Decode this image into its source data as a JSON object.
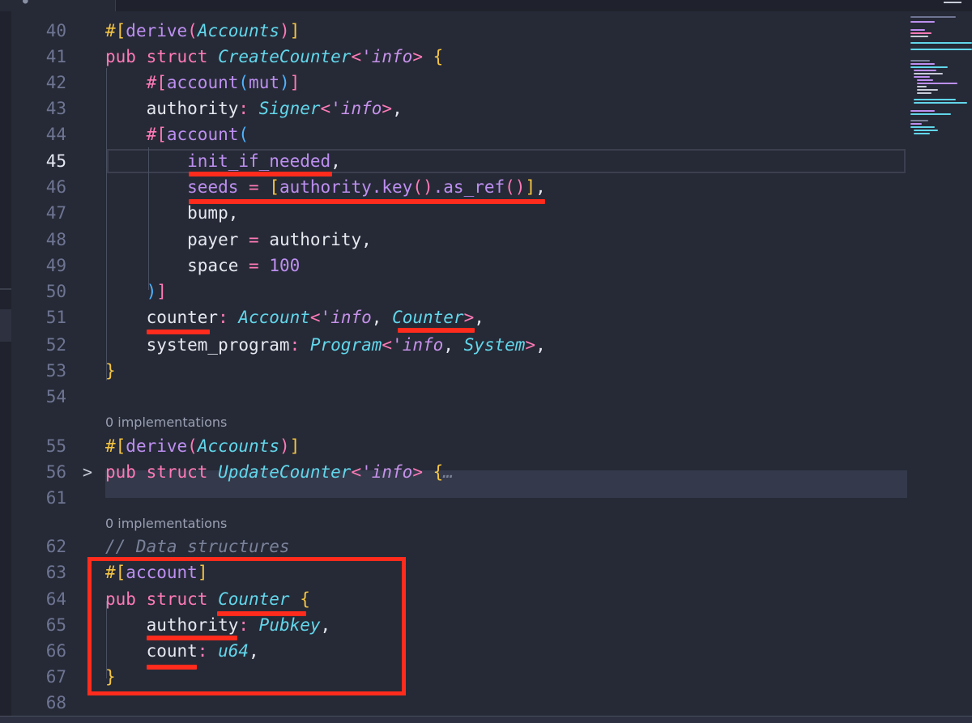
{
  "code": {
    "lines": [
      {
        "n": "40",
        "fold": "",
        "tokens": [
          [
            "br",
            "#["
          ],
          [
            "fn",
            "derive"
          ],
          [
            "br2",
            "("
          ],
          [
            "ty",
            "Accounts"
          ],
          [
            "br2",
            ")"
          ],
          [
            "br",
            "]"
          ]
        ]
      },
      {
        "n": "41",
        "fold": "",
        "tokens": [
          [
            "kw",
            "pub struct "
          ],
          [
            "ty",
            "CreateCounter"
          ],
          [
            "op",
            "<"
          ],
          [
            "lt",
            "'info"
          ],
          [
            "op",
            "> "
          ],
          [
            "br",
            "{"
          ]
        ]
      },
      {
        "n": "42",
        "fold": "",
        "tokens": [
          [
            "pl",
            "    "
          ],
          [
            "br2",
            "#["
          ],
          [
            "fn",
            "account"
          ],
          [
            "br3",
            "("
          ],
          [
            "fn",
            "mut"
          ],
          [
            "br3",
            ")"
          ],
          [
            "br2",
            "]"
          ]
        ]
      },
      {
        "n": "43",
        "fold": "",
        "tokens": [
          [
            "pl",
            "    authority"
          ],
          [
            "op",
            ": "
          ],
          [
            "ty",
            "Signer"
          ],
          [
            "op",
            "<"
          ],
          [
            "lt",
            "'info"
          ],
          [
            "op",
            ">"
          ],
          [
            "pl",
            ","
          ]
        ]
      },
      {
        "n": "44",
        "fold": "",
        "tokens": [
          [
            "pl",
            "    "
          ],
          [
            "br2",
            "#["
          ],
          [
            "fn",
            "account"
          ],
          [
            "br3",
            "("
          ]
        ]
      },
      {
        "n": "45",
        "fold": "",
        "tokens": [
          [
            "pl",
            "        "
          ],
          [
            "fn",
            "init_if_needed"
          ],
          [
            "pl",
            ","
          ]
        ]
      },
      {
        "n": "46",
        "fold": "",
        "tokens": [
          [
            "pl",
            "        "
          ],
          [
            "fn",
            "seeds"
          ],
          [
            "op",
            " = "
          ],
          [
            "br",
            "["
          ],
          [
            "fn",
            "authority.key"
          ],
          [
            "br2",
            "()"
          ],
          [
            "fn",
            ".as_ref"
          ],
          [
            "br2",
            "()"
          ],
          [
            "br",
            "]"
          ],
          [
            "pl",
            ","
          ]
        ]
      },
      {
        "n": "47",
        "fold": "",
        "tokens": [
          [
            "pl",
            "        bump,"
          ]
        ]
      },
      {
        "n": "48",
        "fold": "",
        "tokens": [
          [
            "pl",
            "        payer "
          ],
          [
            "op",
            "="
          ],
          [
            "pl",
            " authority,"
          ]
        ]
      },
      {
        "n": "49",
        "fold": "",
        "tokens": [
          [
            "pl",
            "        space "
          ],
          [
            "op",
            "="
          ],
          [
            "num",
            " 100"
          ]
        ]
      },
      {
        "n": "50",
        "fold": "",
        "tokens": [
          [
            "pl",
            "    "
          ],
          [
            "br3",
            ")"
          ],
          [
            "br2",
            "]"
          ]
        ]
      },
      {
        "n": "51",
        "fold": "",
        "tokens": [
          [
            "pl",
            "    counter"
          ],
          [
            "op",
            ": "
          ],
          [
            "ty",
            "Account"
          ],
          [
            "op",
            "<"
          ],
          [
            "lt",
            "'info"
          ],
          [
            "pl",
            ", "
          ],
          [
            "ty",
            "Counter"
          ],
          [
            "op",
            ">"
          ],
          [
            "pl",
            ","
          ]
        ]
      },
      {
        "n": "52",
        "fold": "",
        "tokens": [
          [
            "pl",
            "    system_program"
          ],
          [
            "op",
            ": "
          ],
          [
            "ty",
            "Program"
          ],
          [
            "op",
            "<"
          ],
          [
            "lt",
            "'info"
          ],
          [
            "pl",
            ", "
          ],
          [
            "ty",
            "System"
          ],
          [
            "op",
            ">"
          ],
          [
            "pl",
            ","
          ]
        ]
      },
      {
        "n": "53",
        "fold": "",
        "tokens": [
          [
            "br",
            "}"
          ]
        ]
      },
      {
        "n": "54",
        "fold": "",
        "tokens": []
      },
      {
        "n": "55",
        "fold": "",
        "tokens": [
          [
            "br",
            "#["
          ],
          [
            "fn",
            "derive"
          ],
          [
            "br2",
            "("
          ],
          [
            "ty",
            "Accounts"
          ],
          [
            "br2",
            ")"
          ],
          [
            "br",
            "]"
          ]
        ]
      },
      {
        "n": "56",
        "fold": ">",
        "tokens": [
          [
            "kw",
            "pub struct "
          ],
          [
            "ty",
            "UpdateCounter"
          ],
          [
            "op",
            "<"
          ],
          [
            "lt",
            "'info"
          ],
          [
            "op",
            "> "
          ],
          [
            "br",
            "{"
          ],
          [
            "cm",
            "…"
          ]
        ]
      },
      {
        "n": "61",
        "fold": "",
        "tokens": []
      },
      {
        "n": "62",
        "fold": "",
        "tokens": [
          [
            "cm",
            "// Data structures"
          ]
        ]
      },
      {
        "n": "63",
        "fold": "",
        "tokens": [
          [
            "br",
            "#["
          ],
          [
            "fn",
            "account"
          ],
          [
            "br",
            "]"
          ]
        ]
      },
      {
        "n": "64",
        "fold": "",
        "tokens": [
          [
            "kw",
            "pub struct "
          ],
          [
            "ty",
            "Counter "
          ],
          [
            "br",
            "{"
          ]
        ]
      },
      {
        "n": "65",
        "fold": "",
        "tokens": [
          [
            "pl",
            "    authority"
          ],
          [
            "op",
            ": "
          ],
          [
            "ty",
            "Pubkey"
          ],
          [
            "pl",
            ","
          ]
        ]
      },
      {
        "n": "66",
        "fold": "",
        "tokens": [
          [
            "pl",
            "    count"
          ],
          [
            "op",
            ": "
          ],
          [
            "ty",
            "u64"
          ],
          [
            "pl",
            ","
          ]
        ]
      },
      {
        "n": "67",
        "fold": "",
        "tokens": [
          [
            "br",
            "}"
          ]
        ]
      },
      {
        "n": "68",
        "fold": "",
        "tokens": []
      }
    ]
  },
  "codelens": [
    "0 implementations",
    "0 implementations"
  ],
  "colors": {
    "accent_annotation": "#ff2b1c",
    "background": "#262a37"
  }
}
